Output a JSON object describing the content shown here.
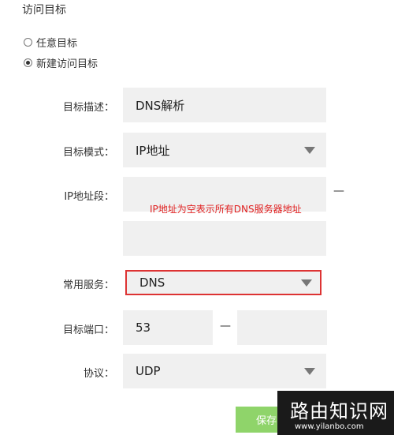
{
  "section_title": "访问目标",
  "target_options": [
    {
      "label": "任意目标",
      "checked": false
    },
    {
      "label": "新建访问目标",
      "checked": true
    }
  ],
  "form": {
    "description": {
      "label": "目标描述：",
      "value": "DNS解析"
    },
    "mode": {
      "label": "目标模式：",
      "value": "IP地址"
    },
    "ip_range": {
      "label": "IP地址段：",
      "from": "",
      "to": "",
      "separator": "—"
    },
    "annotation": "IP地址为空表示所有DNS服务器地址",
    "service": {
      "label": "常用服务：",
      "value": "DNS"
    },
    "port": {
      "label": "目标端口：",
      "from": "53",
      "to": "",
      "separator": "—"
    },
    "protocol": {
      "label": "协议：",
      "value": "UDP"
    }
  },
  "save_button": "保存",
  "watermark": {
    "title": "路由知识网",
    "url": "www.yilanbo.com"
  }
}
